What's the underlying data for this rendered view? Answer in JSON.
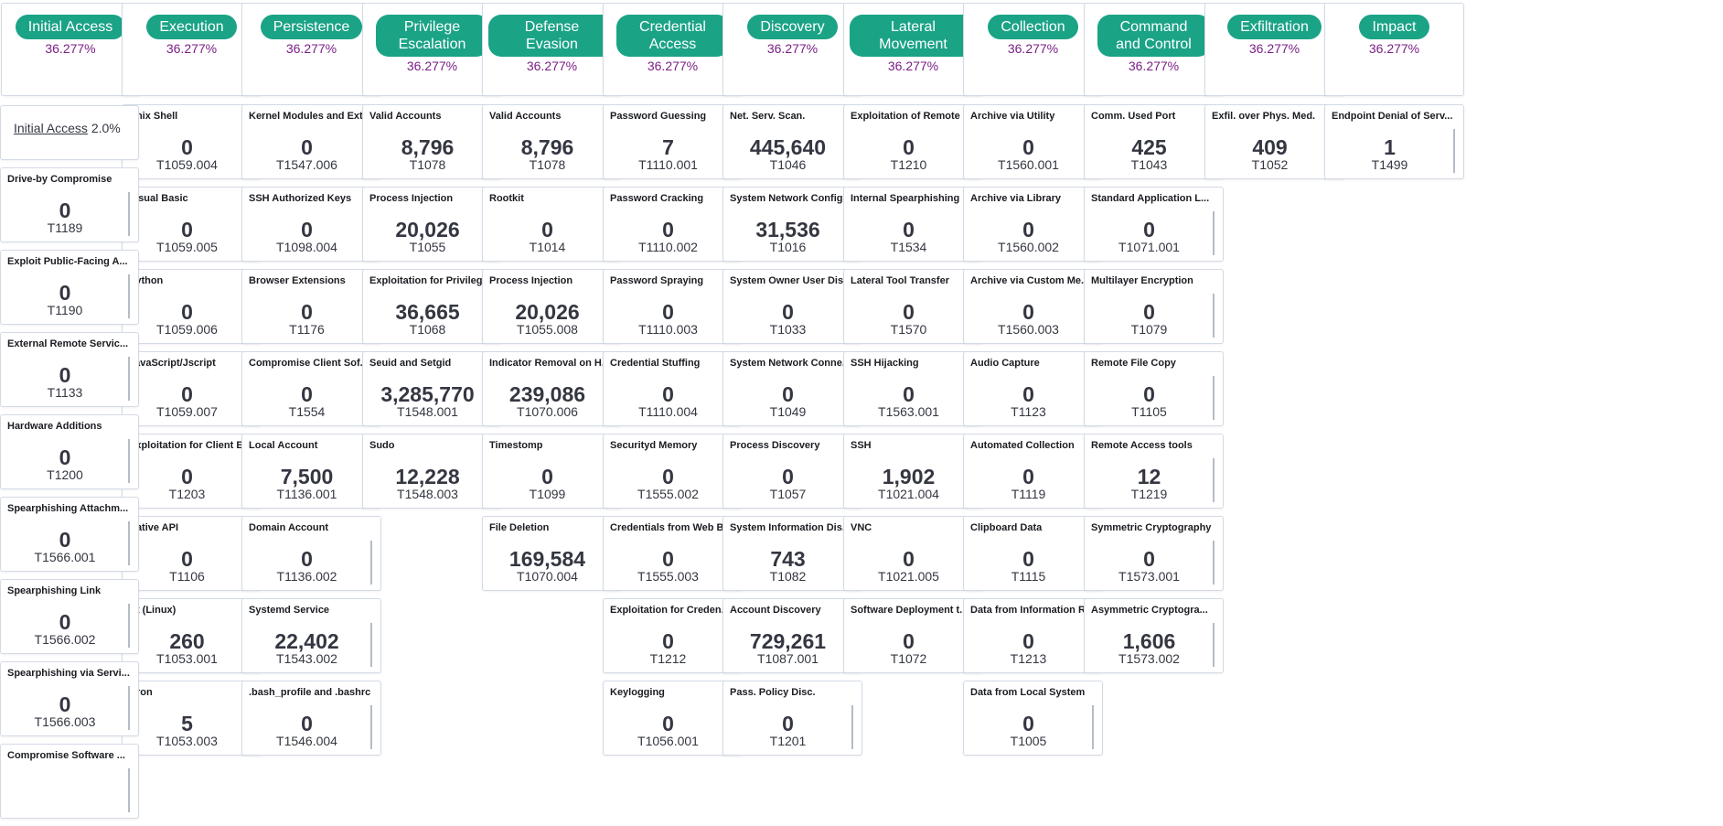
{
  "tactics": [
    {
      "name": "Initial Access",
      "pct": "36.277%",
      "techniques": []
    },
    {
      "name": "Execution",
      "pct": "36.277%",
      "techniques": [
        {
          "title": "Unix Shell",
          "value": "0",
          "id": "T1059.004"
        },
        {
          "title": "Visual Basic",
          "value": "0",
          "id": "T1059.005"
        },
        {
          "title": "Python",
          "value": "0",
          "id": "T1059.006"
        },
        {
          "title": "JavaScript/Jscript",
          "value": "0",
          "id": "T1059.007"
        },
        {
          "title": "Exploitation for Client E...",
          "value": "0",
          "id": "T1203"
        },
        {
          "title": "Native API",
          "value": "0",
          "id": "T1106"
        },
        {
          "title": "At (Linux)",
          "value": "260",
          "id": "T1053.001"
        },
        {
          "title": "Cron",
          "value": "5",
          "id": "T1053.003"
        }
      ]
    },
    {
      "name": "Persistence",
      "pct": "36.277%",
      "techniques": [
        {
          "title": "Kernel Modules and Ext...",
          "value": "0",
          "id": "T1547.006"
        },
        {
          "title": "SSH Authorized Keys",
          "value": "0",
          "id": "T1098.004"
        },
        {
          "title": "Browser Extensions",
          "value": "0",
          "id": "T1176"
        },
        {
          "title": "Compromise Client Sof...",
          "value": "0",
          "id": "T1554"
        },
        {
          "title": "Local Account",
          "value": "7,500",
          "id": "T1136.001"
        },
        {
          "title": "Domain Account",
          "value": "0",
          "id": "T1136.002"
        },
        {
          "title": "Systemd Service",
          "value": "22,402",
          "id": "T1543.002"
        },
        {
          "title": ".bash_profile and .bashrc",
          "value": "0",
          "id": "T1546.004"
        }
      ]
    },
    {
      "name": "Privilege Escalation",
      "pct": "36.277%",
      "techniques": [
        {
          "title": "Valid Accounts",
          "value": "8,796",
          "id": "T1078"
        },
        {
          "title": "Process Injection",
          "value": "20,026",
          "id": "T1055"
        },
        {
          "title": "Exploitation for Privileg...",
          "value": "36,665",
          "id": "T1068"
        },
        {
          "title": "Seuid and Setgid",
          "value": "3,285,770",
          "id": "T1548.001"
        },
        {
          "title": "Sudo",
          "value": "12,228",
          "id": "T1548.003"
        }
      ]
    },
    {
      "name": "Defense Evasion",
      "pct": "36.277%",
      "techniques": [
        {
          "title": "Valid Accounts",
          "value": "8,796",
          "id": "T1078"
        },
        {
          "title": "Rootkit",
          "value": "0",
          "id": "T1014"
        },
        {
          "title": "Process Injection",
          "value": "20,026",
          "id": "T1055.008"
        },
        {
          "title": "Indicator Removal on H...",
          "value": "239,086",
          "id": "T1070.006"
        },
        {
          "title": "Timestomp",
          "value": "0",
          "id": "T1099"
        },
        {
          "title": "File Deletion",
          "value": "169,584",
          "id": "T1070.004"
        }
      ]
    },
    {
      "name": "Credential Access",
      "pct": "36.277%",
      "techniques": [
        {
          "title": "Password Guessing",
          "value": "7",
          "id": "T1110.001"
        },
        {
          "title": "Password Cracking",
          "value": "0",
          "id": "T1110.002"
        },
        {
          "title": "Password Spraying",
          "value": "0",
          "id": "T1110.003"
        },
        {
          "title": "Credential Stuffing",
          "value": "0",
          "id": "T1110.004"
        },
        {
          "title": "Securityd Memory",
          "value": "0",
          "id": "T1555.002"
        },
        {
          "title": "Credentials from Web B...",
          "value": "0",
          "id": "T1555.003"
        },
        {
          "title": "Exploitation for Creden...",
          "value": "0",
          "id": "T1212"
        },
        {
          "title": "Keylogging",
          "value": "0",
          "id": "T1056.001"
        }
      ]
    },
    {
      "name": "Discovery",
      "pct": "36.277%",
      "techniques": [
        {
          "title": "Net. Serv. Scan.",
          "value": "445,640",
          "id": "T1046"
        },
        {
          "title": "System Network Config...",
          "value": "31,536",
          "id": "T1016"
        },
        {
          "title": "System Owner User Dis...",
          "value": "0",
          "id": "T1033"
        },
        {
          "title": "System Network Conne...",
          "value": "0",
          "id": "T1049"
        },
        {
          "title": "Process Discovery",
          "value": "0",
          "id": "T1057"
        },
        {
          "title": "System Information Dis...",
          "value": "743",
          "id": "T1082"
        },
        {
          "title": "Account Discovery",
          "value": "729,261",
          "id": "T1087.001"
        },
        {
          "title": "Pass. Policy Disc.",
          "value": "0",
          "id": "T1201"
        }
      ]
    },
    {
      "name": "Lateral Movement",
      "pct": "36.277%",
      "techniques": [
        {
          "title": "Exploitation of Remote ...",
          "value": "0",
          "id": "T1210"
        },
        {
          "title": "Internal Spearphishing",
          "value": "0",
          "id": "T1534"
        },
        {
          "title": "Lateral Tool Transfer",
          "value": "0",
          "id": "T1570"
        },
        {
          "title": "SSH Hijacking",
          "value": "0",
          "id": "T1563.001"
        },
        {
          "title": "SSH",
          "value": "1,902",
          "id": "T1021.004"
        },
        {
          "title": "VNC",
          "value": "0",
          "id": "T1021.005"
        },
        {
          "title": "Software Deployment t...",
          "value": "0",
          "id": "T1072"
        }
      ]
    },
    {
      "name": "Collection",
      "pct": "36.277%",
      "techniques": [
        {
          "title": "Archive via Utility",
          "value": "0",
          "id": "T1560.001"
        },
        {
          "title": "Archive via Library",
          "value": "0",
          "id": "T1560.002"
        },
        {
          "title": "Archive via Custom Me...",
          "value": "0",
          "id": "T1560.003"
        },
        {
          "title": "Audio Capture",
          "value": "0",
          "id": "T1123"
        },
        {
          "title": "Automated Collection",
          "value": "0",
          "id": "T1119"
        },
        {
          "title": "Clipboard Data",
          "value": "0",
          "id": "T1115"
        },
        {
          "title": "Data from Information R...",
          "value": "0",
          "id": "T1213"
        },
        {
          "title": "Data from Local System",
          "value": "0",
          "id": "T1005"
        }
      ]
    },
    {
      "name": "Command and Control",
      "pct": "36.277%",
      "techniques": [
        {
          "title": "Comm. Used Port",
          "value": "425",
          "id": "T1043"
        },
        {
          "title": "Standard Application L...",
          "value": "0",
          "id": "T1071.001"
        },
        {
          "title": "Multilayer Encryption",
          "value": "0",
          "id": "T1079"
        },
        {
          "title": "Remote File Copy",
          "value": "0",
          "id": "T1105"
        },
        {
          "title": "Remote Access tools",
          "value": "12",
          "id": "T1219"
        },
        {
          "title": "Symmetric Cryptography",
          "value": "0",
          "id": "T1573.001"
        },
        {
          "title": "Asymmetric Cryptogra...",
          "value": "1,606",
          "id": "T1573.002"
        }
      ]
    },
    {
      "name": "Exfiltration",
      "pct": "36.277%",
      "techniques": [
        {
          "title": "Exfil. over Phys. Med.",
          "value": "409",
          "id": "T1052"
        }
      ]
    },
    {
      "name": "Impact",
      "pct": "36.277%",
      "techniques": [
        {
          "title": "Endpoint Denial of Serv...",
          "value": "1",
          "id": "T1499"
        }
      ]
    }
  ],
  "initial_access_summary": {
    "label": "Initial Access",
    "pct": "2.0%"
  },
  "initial_access_techniques": [
    {
      "title": "Drive-by Compromise",
      "value": "0",
      "id": "T1189"
    },
    {
      "title": "Exploit Public-Facing A...",
      "value": "0",
      "id": "T1190"
    },
    {
      "title": "External Remote Servic...",
      "value": "0",
      "id": "T1133"
    },
    {
      "title": "Hardware Additions",
      "value": "0",
      "id": "T1200"
    },
    {
      "title": "Spearphishing Attachm...",
      "value": "0",
      "id": "T1566.001"
    },
    {
      "title": "Spearphishing Link",
      "value": "0",
      "id": "T1566.002"
    },
    {
      "title": "Spearphishing via Servi...",
      "value": "0",
      "id": "T1566.003"
    },
    {
      "title": "Compromise Software ...",
      "value": "",
      "id": ""
    }
  ],
  "colors": {
    "accent": "#1ba386",
    "pct": "#7b1f86",
    "border": "#d3dae6"
  }
}
